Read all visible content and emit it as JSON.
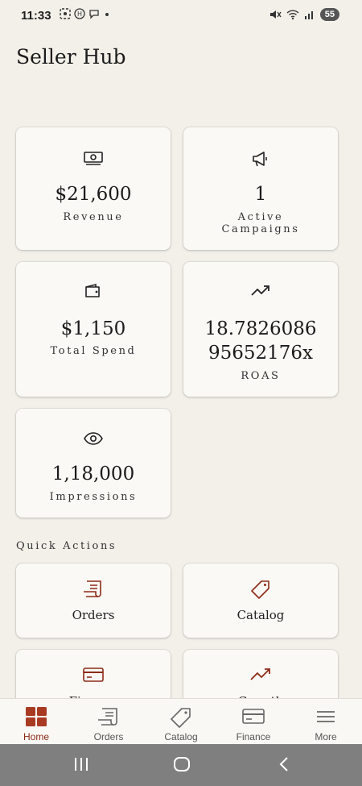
{
  "status": {
    "time": "11:33",
    "battery": "55"
  },
  "app": {
    "title": "Seller Hub"
  },
  "stats": [
    {
      "icon": "money-icon",
      "value": "$21,600",
      "label": "Revenue"
    },
    {
      "icon": "megaphone-icon",
      "value": "1",
      "label_line1": "Active",
      "label_line2": "Campaigns"
    },
    {
      "icon": "wallet-icon",
      "value": "$1,150",
      "label": "Total Spend"
    },
    {
      "icon": "trending-up-icon",
      "value_line1": "18.7826086",
      "value_line2": "95652176x",
      "label": "ROAS"
    },
    {
      "icon": "eye-icon",
      "value": "1,18,000",
      "label": "Impressions"
    }
  ],
  "quick_actions": {
    "title": "Quick Actions",
    "items": [
      {
        "icon": "receipt-icon",
        "label": "Orders"
      },
      {
        "icon": "tag-icon",
        "label": "Catalog"
      },
      {
        "icon": "credit-card-icon",
        "label": "Finance"
      },
      {
        "icon": "trending-up-icon",
        "label": "Growth"
      }
    ]
  },
  "bottom_nav": {
    "items": [
      {
        "icon": "grid-icon",
        "label": "Home"
      },
      {
        "icon": "receipt-icon",
        "label": "Orders"
      },
      {
        "icon": "tag-icon",
        "label": "Catalog"
      },
      {
        "icon": "credit-card-icon",
        "label": "Finance"
      },
      {
        "icon": "menu-icon",
        "label": "More"
      }
    ]
  },
  "colors": {
    "accent": "#8c2a16",
    "background": "#f3f0ea",
    "card": "#fbf9f5"
  }
}
